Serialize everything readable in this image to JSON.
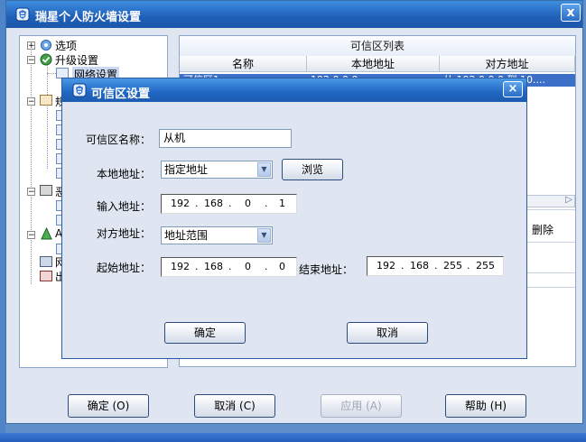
{
  "main": {
    "title": "瑞星个人防火墙设置",
    "close_label": "x"
  },
  "tree": {
    "options": "选项",
    "upgrade": "升级设置",
    "network": "网络设置",
    "rule": "规",
    "evil": "恶",
    "ad": "A",
    "net2": "网",
    "out": "出"
  },
  "list": {
    "title": "可信区列表",
    "columns": [
      "名称",
      "本地地址",
      "对方地址"
    ],
    "row1": [
      "可信区1",
      "192.0.0.0",
      "从 192.0.0.0 到 10...."
    ],
    "delete_label": "删除"
  },
  "dialog": {
    "title": "可信区设置",
    "close_label": "×",
    "name_label": "可信区名称：",
    "name_value": "从机",
    "local_label": "本地地址：",
    "local_value": "指定地址",
    "browse_label": "浏览",
    "input_label": "输入地址：",
    "input_ip": [
      "192",
      "168",
      "0",
      "1"
    ],
    "peer_label": "对方地址：",
    "peer_value": "地址范围",
    "start_label": "起始地址：",
    "start_ip": [
      "192",
      "168",
      "0",
      "0"
    ],
    "end_label": "结束地址：",
    "end_ip": [
      "192",
      "168",
      "255",
      "255"
    ],
    "ok_label": "确定",
    "cancel_label": "取消"
  },
  "buttons": {
    "ok": "确定 (O)",
    "cancel": "取消 (C)",
    "apply": "应用 (A)",
    "help": "帮助 (H)"
  },
  "colors": {
    "title_blue": "#1f5fb8",
    "selection_blue": "#3c6fc7"
  }
}
